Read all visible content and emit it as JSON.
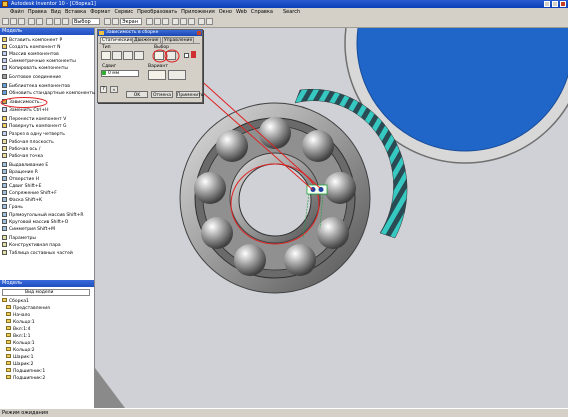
{
  "window": {
    "title": "Autodesk Inventor 10 - [Сборка1]"
  },
  "menu": [
    "Файл",
    "Правка",
    "Вид",
    "Вставка",
    "Формат",
    "Сервис",
    "Преобразовать",
    "Приложения",
    "Окно",
    "Web",
    "Справка",
    "Search"
  ],
  "toolbar": {
    "select_label": "Выбор",
    "zoom_label": "Экран"
  },
  "left_panel": {
    "header": "Модель",
    "commands": [
      "Вставить компонент P",
      "Создать компонент N",
      "Массив компонентов",
      "Симметричные компоненты",
      "Копировать компоненты",
      "Болтовое соединение",
      "Библиотека компонентов",
      "Обновить стандартные компоненты",
      "Зависимость...",
      "Заменить Ctrl+H",
      "Перенести компонент V",
      "Повернуть компонент G",
      "Разрез в одну четверть",
      "Рабочая плоскость",
      "Рабочая ось /",
      "Рабочая точка",
      "Выдавливание E",
      "Вращение R",
      "Отверстие H",
      "Сдвиг Shift+E",
      "Сопряжение Shift+F",
      "Фаска Shift+K",
      "Грань",
      "Прямоугольный массив Shift+R",
      "Круговой массив Shift+O",
      "Симметрия Shift+M",
      "Параметры",
      "Конструктивная пара",
      "Таблица составных частей"
    ],
    "browser_header": "Модель",
    "browser_mode": "Вид модели",
    "tree": [
      "Сборка1",
      "Представления",
      "Начало",
      "Кольцо:1",
      "Вкл:1:4",
      "Вкл:1:1",
      "Кольцо:1",
      "Кольцо:2",
      "Шарик:1",
      "Шарик:2",
      "Подшипник:1",
      "Подшипник:2"
    ]
  },
  "dialog": {
    "title": "Зависимость в сборке",
    "tabs": [
      "Статические",
      "Движение",
      "Управление"
    ],
    "type_label": "Тип",
    "selection_label": "Выбор",
    "offset_label": "Сдвиг",
    "offset_value": "0 мм",
    "solution_label": "Вариант",
    "ok": "OK",
    "cancel": "Отмена",
    "apply": "Применить"
  },
  "status": {
    "text": "Режим ожидания"
  },
  "colors": {
    "title_bar": "#1d4fc4",
    "highlight_red": "#e02020",
    "accent_blue": "#1f66c8",
    "accent_teal": "#2fc8c0"
  }
}
